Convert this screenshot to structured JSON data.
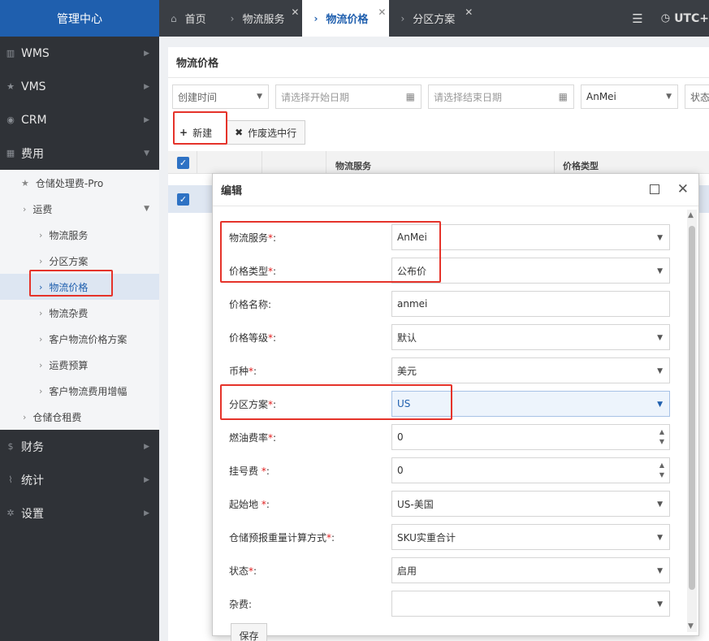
{
  "brand": "管理中心",
  "sidebar": {
    "top_items": [
      {
        "label": "WMS",
        "icon": "bank-icon"
      },
      {
        "label": "VMS",
        "icon": "star-icon"
      },
      {
        "label": "CRM",
        "icon": "user-circle-icon"
      },
      {
        "label": "费用",
        "icon": "table-icon"
      }
    ],
    "sub_items": [
      {
        "label": "仓储处理费-Pro"
      },
      {
        "label": "运费"
      },
      {
        "label": "物流服务"
      },
      {
        "label": "分区方案"
      },
      {
        "label": "物流价格"
      },
      {
        "label": "物流杂费"
      },
      {
        "label": "客户物流价格方案"
      },
      {
        "label": "运费预算"
      },
      {
        "label": "客户物流费用增幅"
      },
      {
        "label": "仓储仓租费"
      }
    ],
    "bottom_items": [
      {
        "label": "财务",
        "icon": "dollar-icon"
      },
      {
        "label": "统计",
        "icon": "chart-icon"
      },
      {
        "label": "设置",
        "icon": "gear-icon"
      }
    ]
  },
  "tabs": [
    {
      "label": "首页"
    },
    {
      "label": "物流服务"
    },
    {
      "label": "物流价格"
    },
    {
      "label": "分区方案"
    }
  ],
  "topbar": {
    "timezone": "UTC+"
  },
  "page": {
    "title": "物流价格",
    "filters": {
      "created_time": "创建时间",
      "start_placeholder": "请选择开始日期",
      "end_placeholder": "请选择结束日期",
      "service": "AnMei",
      "status": "状态"
    },
    "toolbar": {
      "new_label": "新建",
      "void_label": "作废选中行"
    },
    "grid": {
      "col_service": "物流服务",
      "col_price_type": "价格类型"
    }
  },
  "modal": {
    "title": "编辑",
    "fields": [
      {
        "label": "物流服务",
        "required": "*",
        "value": "AnMei",
        "kind": "select"
      },
      {
        "label": "价格类型",
        "required": "*",
        "value": "公布价",
        "kind": "select"
      },
      {
        "label": "价格名称",
        "required": "",
        "value": "anmei",
        "kind": "text"
      },
      {
        "label": "价格等级",
        "required": "*",
        "value": "默认",
        "kind": "select"
      },
      {
        "label": "币种",
        "required": "*",
        "value": "美元",
        "kind": "select"
      },
      {
        "label": "分区方案",
        "required": "*",
        "value": "US",
        "kind": "select"
      },
      {
        "label": "燃油费率",
        "required": "*",
        "value": "0",
        "kind": "number"
      },
      {
        "label": "挂号费 ",
        "required": "*",
        "value": "0",
        "kind": "number"
      },
      {
        "label": "起始地 ",
        "required": "*",
        "value": "US-美国",
        "kind": "select"
      },
      {
        "label": "仓储预报重量计算方式",
        "required": "*",
        "value": "SKU实重合计",
        "kind": "select"
      },
      {
        "label": "状态",
        "required": "*",
        "value": "启用",
        "kind": "select"
      },
      {
        "label": "杂费",
        "required": "",
        "value": "",
        "kind": "select"
      }
    ],
    "save_label": "保存"
  }
}
